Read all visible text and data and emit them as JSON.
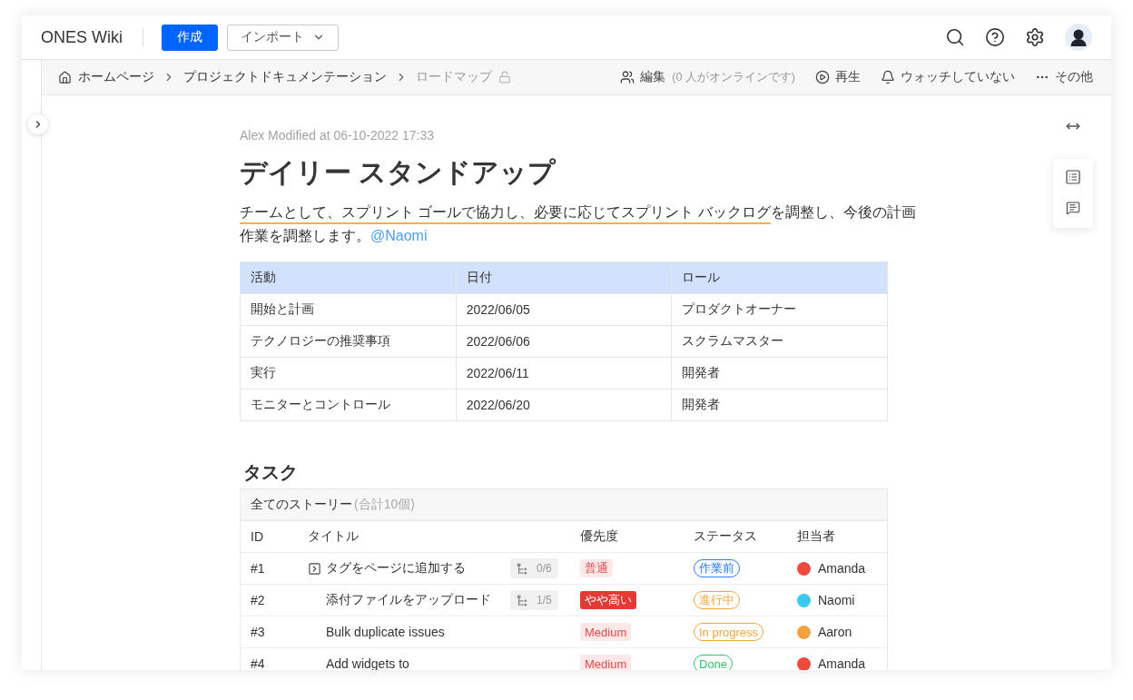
{
  "topbar": {
    "logo": "ONES Wiki",
    "create_button": "作成",
    "import_button": "インポート"
  },
  "breadcrumb": {
    "items": [
      {
        "label": "ホームページ",
        "kind": "home",
        "current": false
      },
      {
        "label": "プロジェクトドキュメンテーション",
        "kind": "page",
        "current": false
      },
      {
        "label": "ロードマップ",
        "kind": "page",
        "current": true
      }
    ],
    "locked": false
  },
  "page_actions": [
    {
      "kind": "edit",
      "label": "編集",
      "note": "(0 人がオンラインです)"
    },
    {
      "kind": "play",
      "label": "再生"
    },
    {
      "kind": "watch",
      "label": "ウォッチしていない"
    },
    {
      "kind": "more",
      "label": "その他"
    }
  ],
  "document": {
    "meta": "Alex Modified at 06-10-2022 17:33",
    "title": "デイリー スタンドアップ",
    "paragraph": [
      {
        "kind": "highlight",
        "text": "チームとして、スプリント ゴールで協力し、必要に応じてスプリント バックログ"
      },
      {
        "kind": "plain",
        "text": "を調整し、今後の計画作業を調整します。"
      },
      {
        "kind": "mention",
        "text": "@Naomi"
      }
    ]
  },
  "activity_table": {
    "columns": [
      "活動",
      "日付",
      "ロール"
    ],
    "rows": [
      [
        "開始と計画",
        "2022/06/05",
        "プロダクトオーナー"
      ],
      [
        "テクノロジーの推奨事項",
        "2022/06/06",
        "スクラムマスター"
      ],
      [
        "実行",
        "2022/06/11",
        "開発者"
      ],
      [
        "モニターとコントロール",
        "2022/06/20",
        "開発者"
      ]
    ]
  },
  "tasks": {
    "heading": "タスク",
    "view": "全てのストーリー",
    "count": "(合計10個)",
    "columns": [
      "ID",
      "タイトル",
      "優先度",
      "ステータス",
      "担当者"
    ],
    "rows": [
      {
        "id": "#1",
        "title": "タグをページに追加する",
        "expanded": false,
        "subtasks": "0/6",
        "priority": {
          "label": "普通",
          "kind": "soft"
        },
        "status": {
          "label": "作業前",
          "color": "#2f7cf6"
        },
        "assignee": {
          "name": "Amanda",
          "color": "#ef4a3f"
        }
      },
      {
        "id": "#2",
        "title": "添付ファイルをアップロード",
        "subtasks": "1/5",
        "priority": {
          "label": "やや高い",
          "kind": "solid"
        },
        "status": {
          "label": "進行中",
          "color": "#f6a53d"
        },
        "assignee": {
          "name": "Naomi",
          "color": "#3cc8f0"
        }
      },
      {
        "id": "#3",
        "title": "Bulk duplicate issues",
        "priority": {
          "label": "Medium",
          "kind": "soft"
        },
        "status": {
          "label": "In progress",
          "color": "#f6a53d"
        },
        "assignee": {
          "name": "Aaron",
          "color": "#f5a142"
        }
      },
      {
        "id": "#4",
        "title": "Add widgets to",
        "priority": {
          "label": "Medium",
          "kind": "soft"
        },
        "status": {
          "label": "Done",
          "color": "#2fc46c"
        },
        "assignee": {
          "name": "Amanda",
          "color": "#ef4a3f"
        }
      }
    ]
  }
}
